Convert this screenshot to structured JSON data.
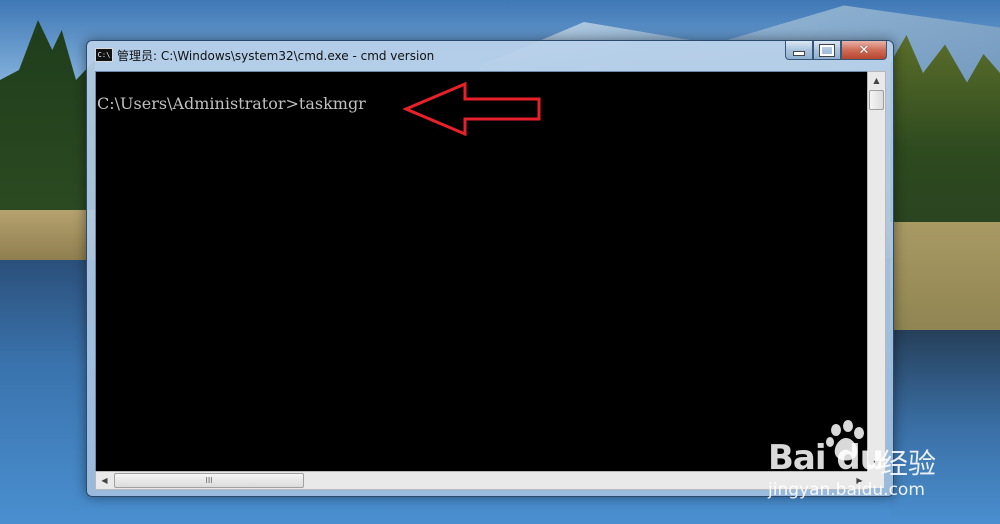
{
  "window": {
    "title": "管理员: C:\\Windows\\system32\\cmd.exe - cmd  version",
    "icon_text": "C:\\",
    "minimize_icon": "minimize-icon",
    "maximize_icon": "maximize-icon",
    "close_glyph": "✕"
  },
  "console": {
    "prompt_line": "C:\\Users\\Administrator>taskmgr",
    "text_color": "#c0c0c0",
    "background": "#000000"
  },
  "annotation": {
    "type": "red-outline-arrow",
    "color": "#e8202a",
    "points_to": "taskmgr"
  },
  "scrollbars": {
    "vertical_up": "▲",
    "vertical_down": "▼",
    "horizontal_left": "◀",
    "horizontal_right": "▶",
    "thumb_grip": "III"
  },
  "watermark": {
    "logo": "Bai du",
    "cn_text": "经验",
    "url": "jingyan.baidu.com"
  }
}
